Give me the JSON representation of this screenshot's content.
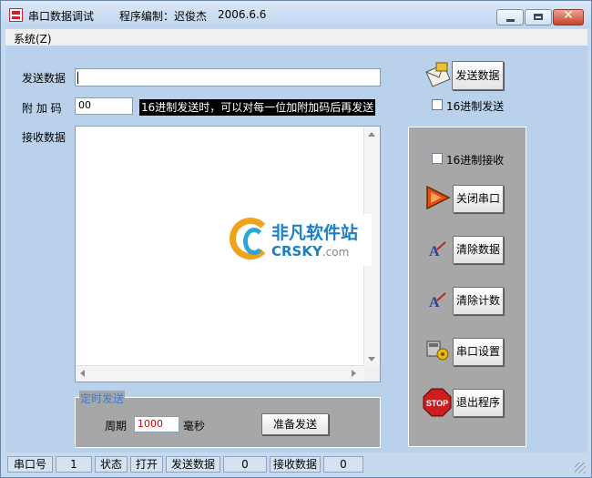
{
  "window": {
    "title": "串口数据调试",
    "author": "程序编制：迟俊杰",
    "date": "2006.6.6",
    "close_glyph": "✕"
  },
  "menu": {
    "system": "系统(Z)"
  },
  "form": {
    "send_label": "发送数据",
    "send_value": "",
    "addcode_label": "附 加 码",
    "addcode_value": "00",
    "hint": "16进制发送时，可以对每一位加附加码后再发送",
    "receive_label": "接收数据",
    "receive_value": ""
  },
  "watermark": {
    "cn": "非凡软件站",
    "en": "CRSKY",
    "domain": ".com"
  },
  "timer": {
    "group_title": "定时发送",
    "period_label": "周期",
    "period_value": "1000",
    "unit": "毫秒",
    "ready_button": "准备发送"
  },
  "right": {
    "send_button": "发送数据",
    "hex_send": "16进制发送",
    "hex_receive": "16进制接收",
    "close_port": "关闭串口",
    "clear_data": "清除数据",
    "clear_count": "清除计数",
    "port_settings": "串口设置",
    "exit": "退出程序"
  },
  "status": {
    "port_label": "串口号",
    "port_value": "1",
    "state_label": "状态",
    "state_value": "打开",
    "sent_label": "发送数据",
    "sent_value": "0",
    "recv_label": "接收数据",
    "recv_value": "0"
  },
  "colors": {
    "client_bg": "#b9d1ea",
    "panel_bg": "#a7a7a7",
    "group_title": "#3a7bd5",
    "hint_bg": "#000000",
    "period_text": "#cc0000"
  }
}
